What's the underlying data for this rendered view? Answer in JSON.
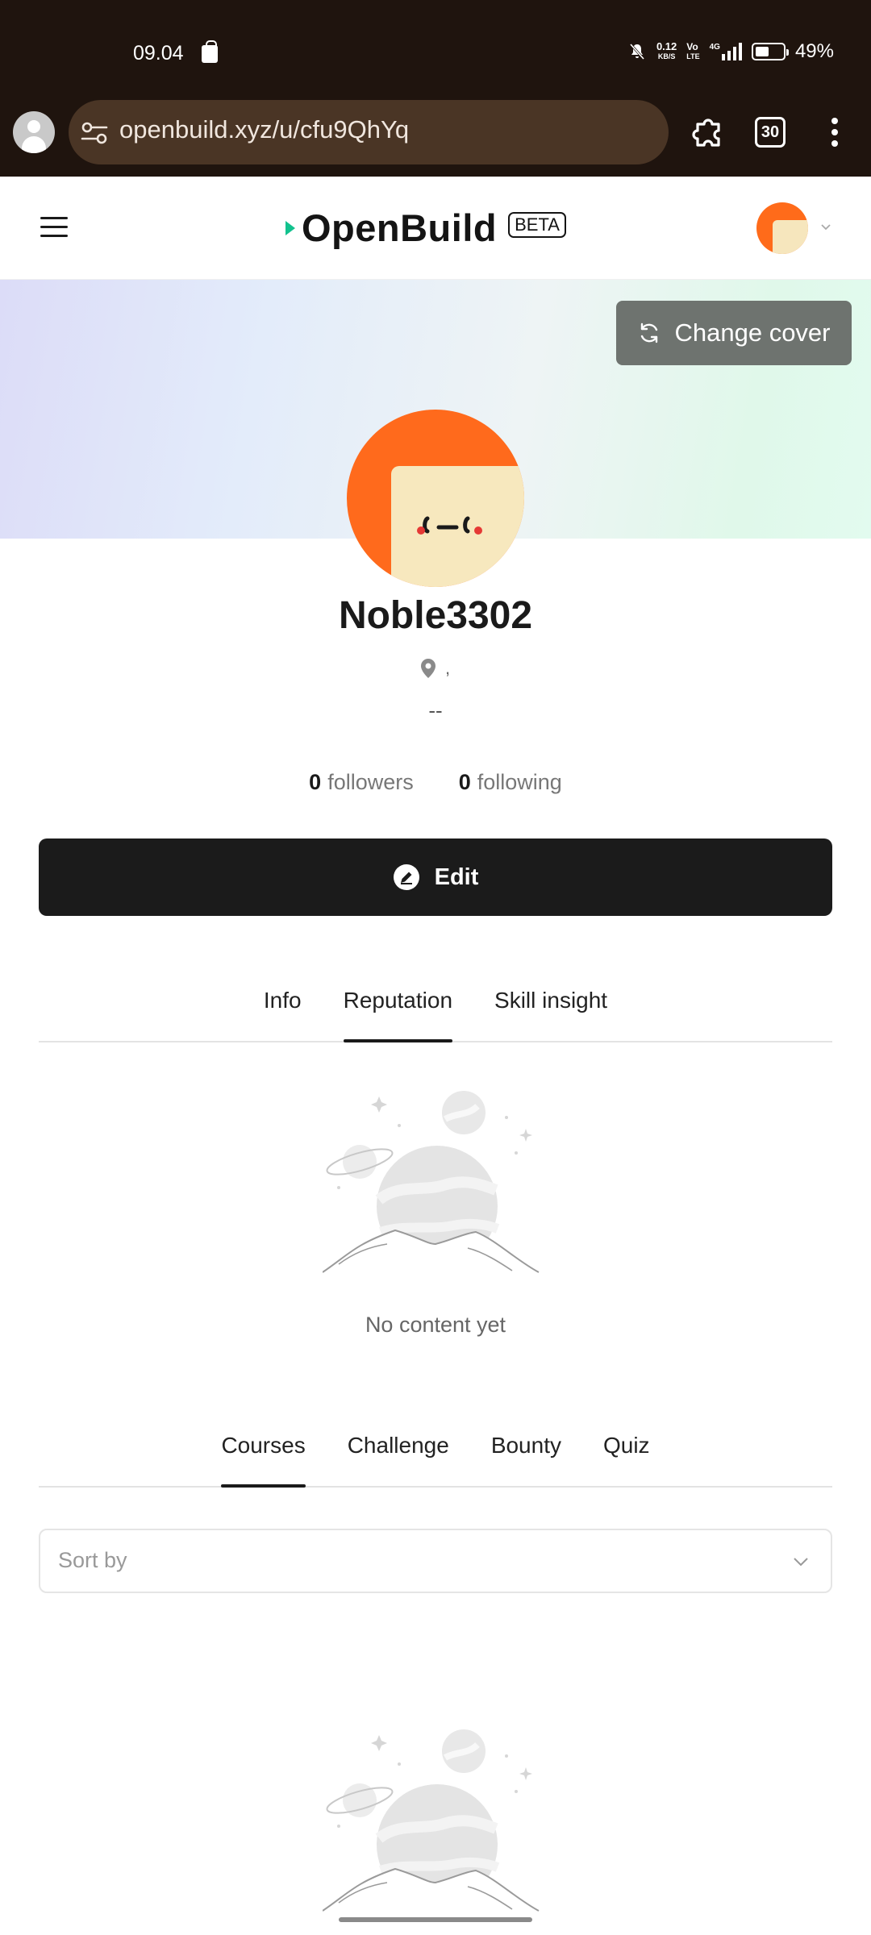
{
  "status_bar": {
    "time": "09.04",
    "net_speed_top": "0.12",
    "net_speed_unit": "KB/S",
    "volte_top": "Vo",
    "volte_bottom": "LTE",
    "network_type": "4G",
    "battery": "49%"
  },
  "browser": {
    "url": "openbuild.xyz/u/cfu9QhYq",
    "tab_count": "30",
    "icons": [
      "profile-icon",
      "site-settings-icon",
      "extensions-icon",
      "tab-switcher-icon",
      "more-options-icon"
    ]
  },
  "site": {
    "logo_text": "OpenBuild",
    "badge": "BETA",
    "accent": "#12c28e"
  },
  "cover": {
    "change_cover_label": "Change cover"
  },
  "profile": {
    "username": "Noble3302",
    "location": ",",
    "bio": "--",
    "followers_count": "0",
    "followers_label": "followers",
    "following_count": "0",
    "following_label": "following",
    "edit_label": "Edit",
    "avatar_colors": {
      "background": "#ff6a1c",
      "face": "#f7e8be"
    }
  },
  "profile_tabs": {
    "items": [
      {
        "label": "Info"
      },
      {
        "label": "Reputation",
        "active": true
      },
      {
        "label": "Skill insight"
      }
    ],
    "empty_text": "No content yet"
  },
  "activity_tabs": {
    "items": [
      {
        "label": "Courses",
        "active": true
      },
      {
        "label": "Challenge"
      },
      {
        "label": "Bounty"
      },
      {
        "label": "Quiz"
      }
    ],
    "sort_placeholder": "Sort by"
  }
}
